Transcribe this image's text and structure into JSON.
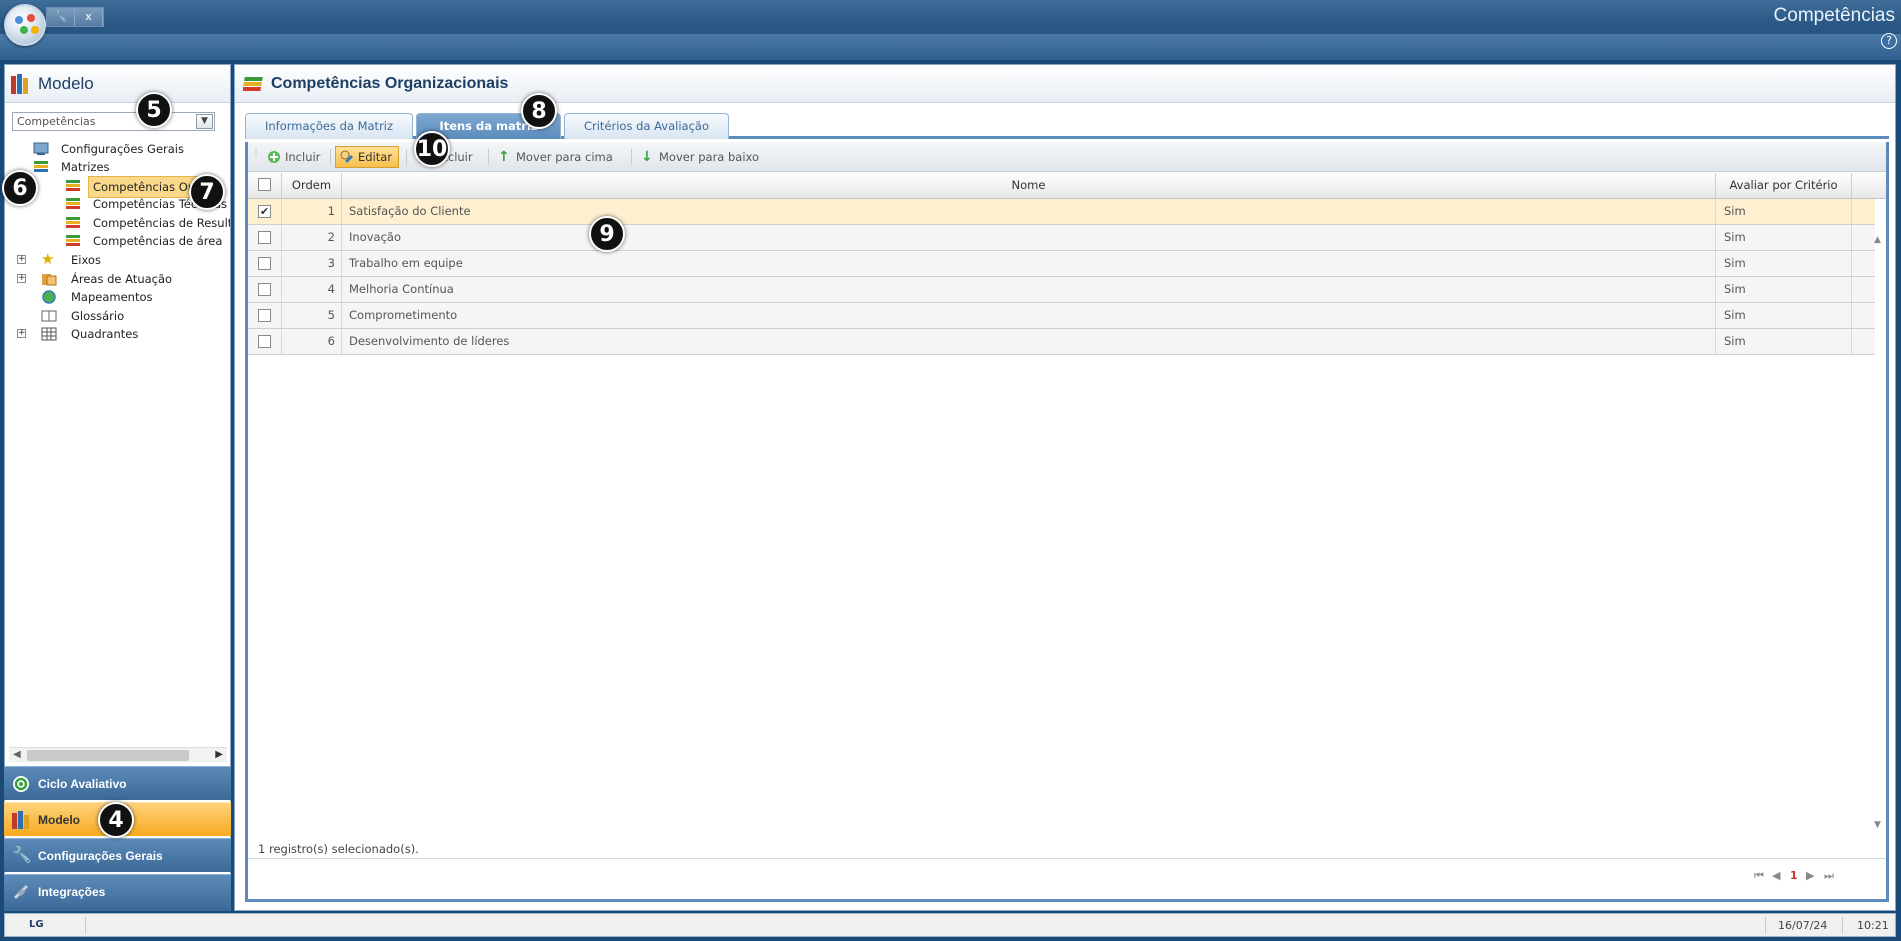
{
  "app": {
    "title": "Competências",
    "toolbar_close": "x",
    "help": "?"
  },
  "left_panel": {
    "title": "Modelo",
    "combo_value": "Competências",
    "tree": [
      {
        "label": "Configurações Gerais",
        "icon": "config-icon"
      },
      {
        "label": "Matrizes",
        "icon": "stack-icon"
      },
      {
        "label": "Competências Organizacionais",
        "icon": "stack-icon",
        "selected": true,
        "display": "Competências Org"
      },
      {
        "label": "Competências Técnicas",
        "icon": "stack-icon"
      },
      {
        "label": "Competências de Resultado",
        "icon": "stack-icon",
        "display": "Competências de Resulta"
      },
      {
        "label": "Competências de área",
        "icon": "stack-icon"
      },
      {
        "label": "Eixos",
        "icon": "star-icon"
      },
      {
        "label": "Áreas de Atuação",
        "icon": "folder-icon"
      },
      {
        "label": "Mapeamentos",
        "icon": "globe-icon"
      },
      {
        "label": "Glossário",
        "icon": "book-icon"
      },
      {
        "label": "Quadrantes",
        "icon": "grid-icon"
      }
    ]
  },
  "nav": [
    {
      "label": "Ciclo Avaliativo",
      "icon": "cycle-icon"
    },
    {
      "label": "Modelo",
      "icon": "model-icon",
      "active": true
    },
    {
      "label": "Configurações Gerais",
      "icon": "wrench-icon"
    },
    {
      "label": "Integrações",
      "icon": "plug-icon"
    }
  ],
  "main": {
    "title": "Competências Organizacionais",
    "tabs": [
      "Informações da Matriz",
      "Itens da matriz",
      "Critérios da Avaliação"
    ],
    "active_tab": "Itens da matriz",
    "toolbar": {
      "add": "Incluir",
      "edit": "Editar",
      "delete": "Excluir",
      "move_up": "Mover para cima",
      "move_down": "Mover para baixo"
    },
    "grid": {
      "columns": [
        "Ordem",
        "Nome",
        "Avaliar por Critério"
      ],
      "rows": [
        {
          "order": "1",
          "name": "Satisfação do Cliente",
          "criteria": "Sim",
          "checked": true
        },
        {
          "order": "2",
          "name": "Inovação",
          "criteria": "Sim",
          "checked": false
        },
        {
          "order": "3",
          "name": "Trabalho em equipe",
          "criteria": "Sim",
          "checked": false
        },
        {
          "order": "4",
          "name": "Melhoria Contínua",
          "criteria": "Sim",
          "checked": false
        },
        {
          "order": "5",
          "name": "Comprometimento",
          "criteria": "Sim",
          "checked": false
        },
        {
          "order": "6",
          "name": "Desenvolvimento de líderes",
          "criteria": "Sim",
          "checked": false
        }
      ]
    },
    "status": "1 registro(s) selecionado(s).",
    "page": "1"
  },
  "footer": {
    "brand": "LG",
    "date": "16/07/24",
    "time": "10:21"
  },
  "callouts": [
    "4",
    "5",
    "6",
    "7",
    "8",
    "9",
    "10"
  ],
  "colors": {
    "accent": "#5b8cbd",
    "highlight": "#f7bf4c",
    "header": "#2a5884"
  }
}
